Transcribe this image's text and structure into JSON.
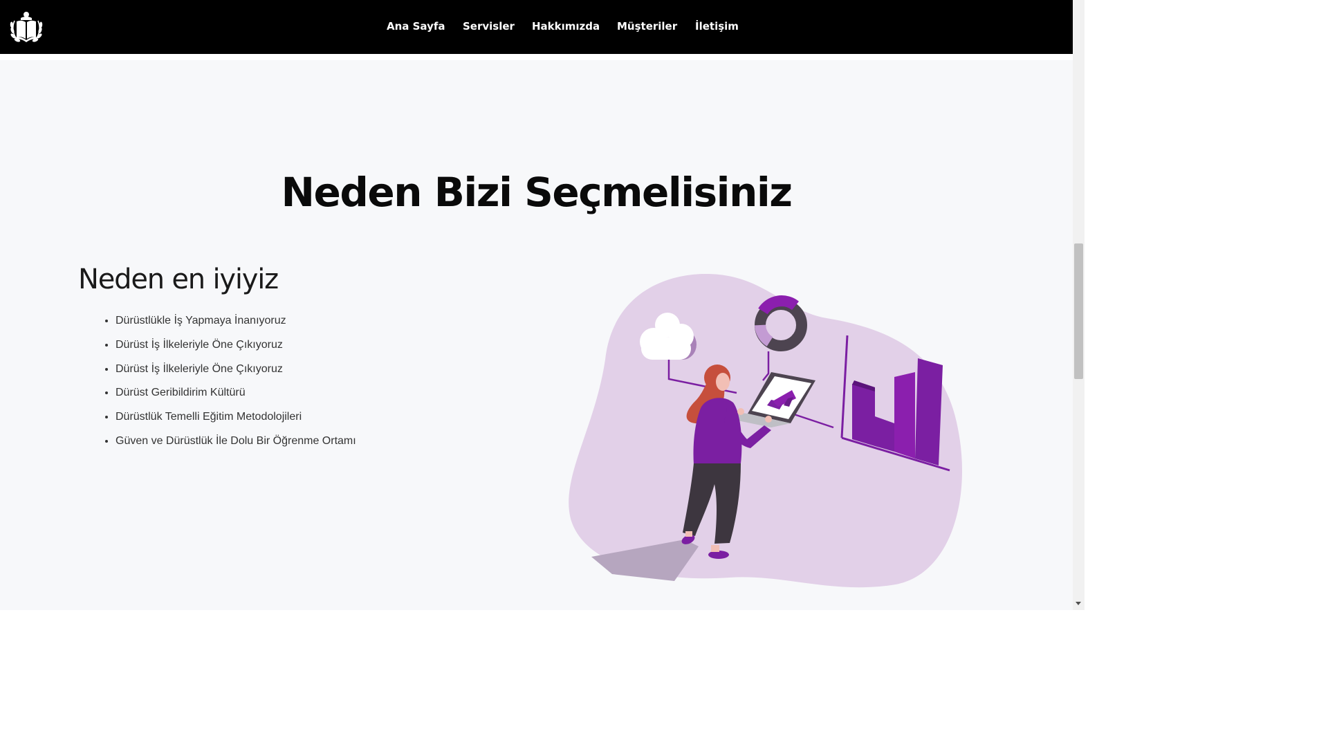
{
  "navbar": {
    "links": [
      {
        "label": "Ana Sayfa"
      },
      {
        "label": "Servisler"
      },
      {
        "label": "Hakkımızda"
      },
      {
        "label": "Müşteriler"
      },
      {
        "label": "İletişim"
      }
    ]
  },
  "main": {
    "title": "Neden Bizi Seçmelisiniz",
    "subtitle": "Neden en iyiyiz",
    "reasons": [
      "Dürüstlükle İş Yapmaya İnanıyoruz",
      "Dürüst İş İlkeleriyle Öne Çıkıyoruz",
      "Dürüst İş İlkeleriyle Öne Çıkıyoruz",
      "Dürüst Geribildirim Kültürü",
      "Dürüstlük Temelli Eğitim Metodolojileri",
      "Güven ve Dürüstlük İle Dolu Bir Öğrenme Ortamı"
    ]
  },
  "colors": {
    "navbar_bg": "#000000",
    "section_bg": "#f7f8fa",
    "accent_purple": "#7b1fa2",
    "blob_lilac": "#e2d0e8"
  },
  "icons": {
    "logo": "book-laurel-logo-icon",
    "illustration": "woman-laptop-analytics-illustration"
  }
}
